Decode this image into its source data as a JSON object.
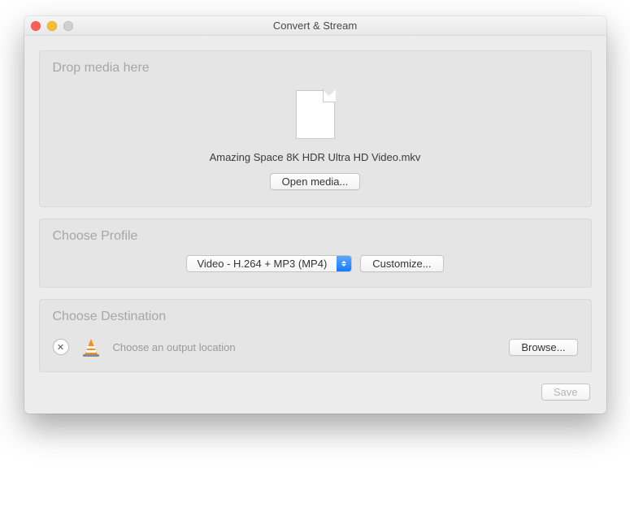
{
  "window": {
    "title": "Convert & Stream"
  },
  "drop": {
    "title": "Drop media here",
    "filename": "Amazing Space 8K HDR Ultra HD Video.mkv",
    "open_btn": "Open media..."
  },
  "profile": {
    "title": "Choose Profile",
    "selected": "Video - H.264 + MP3 (MP4)",
    "customize_btn": "Customize..."
  },
  "destination": {
    "title": "Choose Destination",
    "placeholder": "Choose an output location",
    "browse_btn": "Browse..."
  },
  "footer": {
    "save_btn": "Save"
  }
}
